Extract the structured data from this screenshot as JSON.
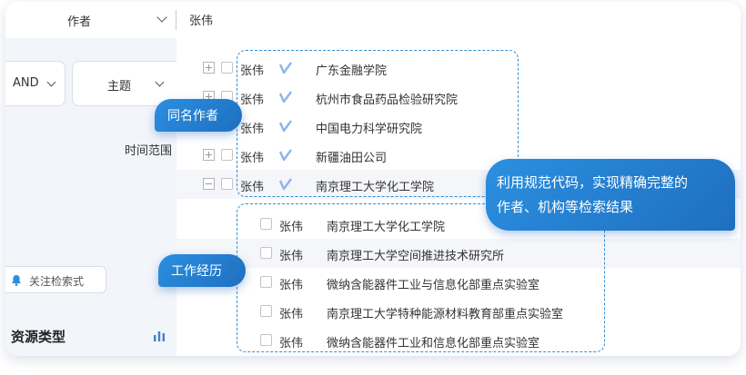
{
  "search": {
    "field_label": "作者",
    "value": "张伟"
  },
  "left": {
    "logic_label": "AND",
    "field_label": "主题",
    "time_range_label": "时间范围",
    "follow_button_label": "关注检索式",
    "resource_type_title": "资源类型"
  },
  "same_name_authors": [
    {
      "name": "张伟",
      "institution": "广东金融学院",
      "expander": "plus"
    },
    {
      "name": "张伟",
      "institution": "杭州市食品药品检验研究院",
      "expander": "plus"
    },
    {
      "name": "张伟",
      "institution": "中国电力科学研究院",
      "expander": "plus"
    },
    {
      "name": "张伟",
      "institution": "新疆油田公司",
      "expander": "plus"
    },
    {
      "name": "张伟",
      "institution": "南京理工大学化工学院",
      "expander": "minus"
    }
  ],
  "work_history": [
    {
      "name": "张伟",
      "institution": "南京理工大学化工学院"
    },
    {
      "name": "张伟",
      "institution": "南京理工大学空间推进技术研究所"
    },
    {
      "name": "张伟",
      "institution": "微纳含能器件工业与信息化部重点实验室"
    },
    {
      "name": "张伟",
      "institution": "南京理工大学特种能源材料教育部重点实验室"
    },
    {
      "name": "张伟",
      "institution": "微纳含能器件工业和信息化部重点实验室"
    }
  ],
  "callouts": {
    "same_name": "同名作者",
    "work_history": "工作经历",
    "summary_line1": "利用规范代码，实现精确完整的",
    "summary_line2": "作者、机构等检索结果"
  },
  "colors": {
    "accent": "#2b8fe0",
    "dash": "#2f8fd8",
    "verify_icon": "#8fb3ec"
  }
}
